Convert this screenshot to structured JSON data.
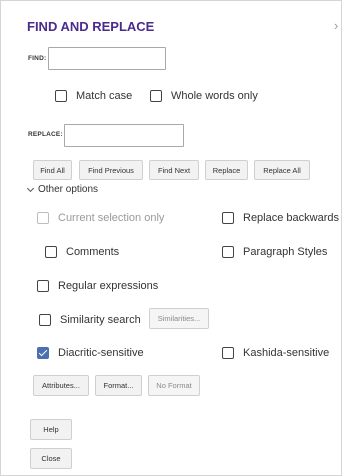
{
  "dialog": {
    "title": "FIND AND REPLACE",
    "close_glyph": "›"
  },
  "find": {
    "label": "FIND:",
    "value": "",
    "placeholder": ""
  },
  "basic_options": {
    "match_case": {
      "label": "Match case",
      "checked": false
    },
    "whole_words": {
      "label": "Whole words only",
      "checked": false
    }
  },
  "replace": {
    "label": "REPLACE:",
    "value": "",
    "placeholder": ""
  },
  "actions": {
    "find_all": "Find All",
    "find_previous": "Find Previous",
    "find_next": "Find Next",
    "replace": "Replace",
    "replace_all": "Replace All"
  },
  "other_options": {
    "toggle_label": "Other options",
    "expanded": true,
    "current_selection_only": {
      "label": "Current selection only",
      "checked": false,
      "enabled": false
    },
    "replace_backwards": {
      "label": "Replace backwards",
      "checked": false
    },
    "comments": {
      "label": "Comments",
      "checked": false
    },
    "paragraph_styles": {
      "label": "Paragraph Styles",
      "checked": false
    },
    "regular_expressions": {
      "label": "Regular expressions",
      "checked": false
    },
    "similarity_search": {
      "label": "Similarity search",
      "checked": false
    },
    "similarities_button": "Similarities...",
    "diacritic_sensitive": {
      "label": "Diacritic-sensitive",
      "checked": true
    },
    "kashida_sensitive": {
      "label": "Kashida-sensitive",
      "checked": false
    },
    "attributes_button": "Attributes...",
    "format_button": "Format...",
    "no_format_button": "No Format"
  },
  "footer": {
    "help": "Help",
    "close": "Close"
  },
  "colors": {
    "title": "#4b2b8e",
    "checkbox_checked": "#4b6fb1",
    "button_bg": "#f2f2f2",
    "border": "#a8a8a8"
  }
}
